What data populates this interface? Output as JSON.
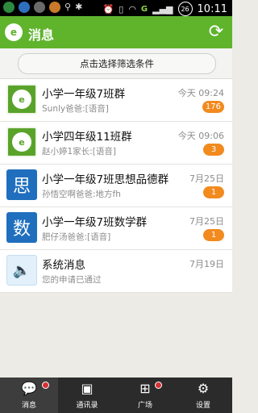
{
  "status_bar": {
    "time": "10:11",
    "signal_label": "G",
    "badge": "26"
  },
  "header": {
    "title": "消息"
  },
  "filter": {
    "label": "点击选择筛选条件"
  },
  "messages": [
    {
      "name": "小学一年级7班群",
      "preview": "Sunly爸爸:[语音]",
      "time": "今天 09:24",
      "badge": "176",
      "avatar": "group"
    },
    {
      "name": "小学四年级11班群",
      "preview": "赵小婷1家长:[语音]",
      "time": "今天 09:06",
      "badge": "3",
      "avatar": "group"
    },
    {
      "name": "小学一年级7班思想品德群",
      "preview": "孙悟空啊爸爸:地方fh",
      "time": "7月25日",
      "badge": "1",
      "avatar_char": "思"
    },
    {
      "name": "小学一年级7班数学群",
      "preview": "肥仔汤爸爸:[语音]",
      "time": "7月25日",
      "badge": "1",
      "avatar_char": "数"
    },
    {
      "name": "系统消息",
      "preview": "您的申请已通过",
      "time": "7月19日",
      "avatar": "speaker"
    }
  ],
  "tabs": [
    {
      "label": "消息",
      "icon": "chat-bubbles-icon",
      "active": true
    },
    {
      "label": "通讯录",
      "icon": "contacts-icon"
    },
    {
      "label": "广场",
      "icon": "grid-icon"
    },
    {
      "label": "设置",
      "icon": "gear-icon"
    }
  ],
  "colors": {
    "brand_green": "#5fb42c",
    "badge_orange": "#f28a1e",
    "avatar_blue": "#1f6fbe"
  }
}
